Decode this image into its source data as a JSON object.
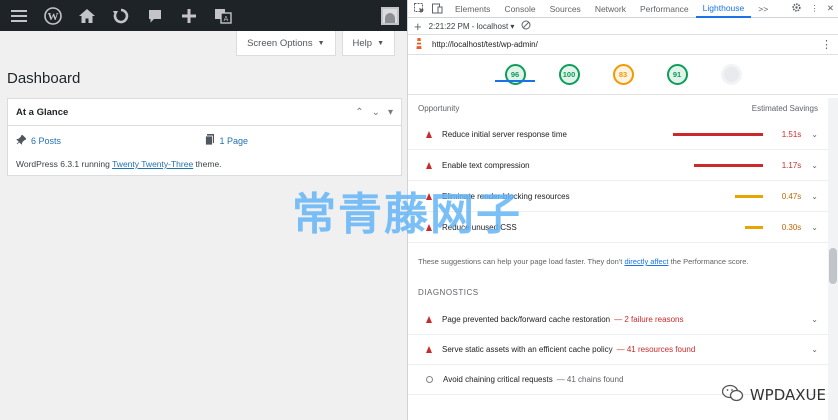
{
  "wp": {
    "toolbar_icons": [
      "menu-icon",
      "wordpress-logo-icon",
      "home-icon",
      "updates-icon",
      "comments-icon",
      "new-content-icon",
      "translate-icon"
    ],
    "screen_options": "Screen Options",
    "help": "Help",
    "page_title": "Dashboard",
    "glance": {
      "title": "At a Glance",
      "posts": "6 Posts",
      "pages": "1 Page",
      "footer_prefix": "WordPress 6.3.1 running ",
      "theme": "Twenty Twenty-Three",
      "footer_suffix": " theme."
    }
  },
  "devtools": {
    "tabs": [
      "Elements",
      "Console",
      "Sources",
      "Network",
      "Performance",
      "Lighthouse"
    ],
    "active_tab": "Lighthouse",
    "more": ">>",
    "report_time": "2:21:22 PM - localhost",
    "url": "http://localhost/test/wp-admin/",
    "scores": [
      {
        "value": "96",
        "color": "#0c9d58"
      },
      {
        "value": "100",
        "color": "#0c9d58"
      },
      {
        "value": "83",
        "color": "#f29900"
      },
      {
        "value": "91",
        "color": "#0c9d58"
      }
    ],
    "opportunity_label": "Opportunity",
    "estimated_savings_label": "Estimated Savings",
    "opportunities": [
      {
        "title": "Reduce initial server response time",
        "value": "1.51s",
        "fraction": 1.0,
        "color": "#cc2a2a"
      },
      {
        "title": "Enable text compression",
        "value": "1.17s",
        "fraction": 0.77,
        "color": "#cc2a2a"
      },
      {
        "title": "Eliminate render-blocking resources",
        "value": "0.47s",
        "fraction": 0.31,
        "color": "#e8a400"
      },
      {
        "title": "Reduce unused CSS",
        "value": "0.30s",
        "fraction": 0.2,
        "color": "#e8a400"
      }
    ],
    "note_prefix": "These suggestions can help your page load faster. They don't ",
    "note_link": "directly affect",
    "note_suffix": " the Performance score.",
    "diagnostics_label": "DIAGNOSTICS",
    "diagnostics": [
      {
        "title": "Page prevented back/forward cache restoration",
        "detail": "— 2 failure reasons"
      },
      {
        "title": "Serve static assets with an efficient cache policy",
        "detail": "— 41 resources found"
      },
      {
        "title": "Avoid chaining critical requests",
        "detail": "— 41 chains found"
      }
    ]
  },
  "watermark": {
    "text": "常青藤网子",
    "brand": "WPDAXUE"
  }
}
